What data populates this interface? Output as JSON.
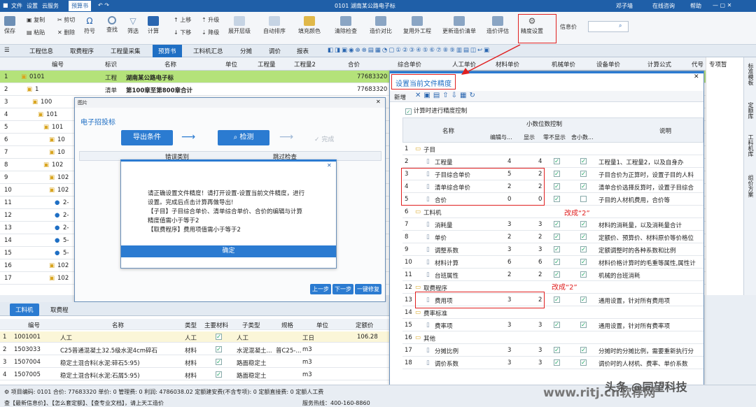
{
  "titlebar": {
    "menus": [
      "文件",
      "设置",
      "云服务",
      "预算书"
    ],
    "doc": "0101 湖南某公路电子标",
    "user": "邓子墙",
    "online": "在线咨询",
    "help": "帮助"
  },
  "ribbon": {
    "save": "保存",
    "copy": "复制",
    "cut": "剪切",
    "paste": "粘贴",
    "delete": "删除",
    "symbol": "符号",
    "find": "查找",
    "filter": "筛选",
    "calc": "计算",
    "up": "上移",
    "down": "下移",
    "upgrade": "升级",
    "downgrade": "降级",
    "expand": "展开层级",
    "autosort": "自动排序",
    "fillcolor": "填充颜色",
    "clearcheck": "清除检查",
    "pricecompare": "造价对比",
    "copyother": "复用外工程",
    "updatelist": "更新造价清单",
    "evaluate": "造价评估",
    "precision": "精度设置",
    "infoprice": "信息价"
  },
  "tabs": [
    "工程信息",
    "取费程序",
    "工程量采集",
    "预算书",
    "工料机汇总",
    "分摊",
    "调价",
    "报表"
  ],
  "grid": {
    "headers": [
      "编号",
      "标识",
      "名称",
      "单位",
      "工程量",
      "工程量2",
      "合价",
      "综合单价",
      "人工单价",
      "材料单价",
      "机械单价",
      "设备单价",
      "计算公式",
      "代号",
      "专项暂"
    ],
    "rows": [
      {
        "n": "1",
        "code": "0101",
        "flag": "工程",
        "name": "湖南某公路电子标",
        "total": "77683320"
      },
      {
        "n": "2",
        "code": "1",
        "flag": "清单",
        "name": "第100章至第800章合计",
        "total": "77683320"
      },
      {
        "n": "3",
        "code": "100",
        "flag": "",
        "name": "",
        "total": ""
      },
      {
        "n": "4",
        "code": "101",
        "flag": "",
        "name": "",
        "total": ""
      },
      {
        "n": "5",
        "code": "101",
        "flag": "",
        "name": "",
        "total": ""
      },
      {
        "n": "6",
        "code": "10",
        "flag": "",
        "name": "",
        "total": ""
      },
      {
        "n": "7",
        "code": "10",
        "flag": "",
        "name": "",
        "total": ""
      },
      {
        "n": "8",
        "code": "102",
        "flag": "",
        "name": "",
        "total": ""
      },
      {
        "n": "9",
        "code": "102",
        "flag": "",
        "name": "",
        "total": ""
      },
      {
        "n": "10",
        "code": "102",
        "flag": "",
        "name": "",
        "total": ""
      },
      {
        "n": "11",
        "code": "2-",
        "flag": "",
        "name": "",
        "total": ""
      },
      {
        "n": "12",
        "code": "2-",
        "flag": "",
        "name": "",
        "total": ""
      },
      {
        "n": "13",
        "code": "2-",
        "flag": "",
        "name": "",
        "total": ""
      },
      {
        "n": "14",
        "code": "5-",
        "flag": "",
        "name": "",
        "total": ""
      },
      {
        "n": "15",
        "code": "5-",
        "flag": "",
        "name": "",
        "total": ""
      },
      {
        "n": "16",
        "code": "102",
        "flag": "",
        "name": "",
        "total": ""
      },
      {
        "n": "17",
        "code": "102",
        "flag": "",
        "name": "",
        "total": ""
      }
    ]
  },
  "sidetabs": [
    "标准模板",
    "定额库",
    "工料机库",
    "组价方案"
  ],
  "ebid": {
    "window_title": "图片",
    "title": "电子招投标",
    "export": "导出条件",
    "check": "检测",
    "done": "完成",
    "col_err": "错误类别",
    "col_skip": "跳过检查",
    "prev": "上一步",
    "next": "下一步",
    "fix": "一键修复",
    "msg_lines": [
      "请正确设置文件精度！请打开设置-设置当前文件精度，进行",
      "设置。完成后点击计算再做导出!",
      "【子目】子目综合单价、清单综合单价、合价的编辑与计算",
      "精度值需小于等于2",
      "【取费程序】费用项值需小于等于2"
    ],
    "ok": "确定"
  },
  "precision": {
    "title": "设置当前文件精度",
    "new": "新增",
    "option": "计算时进行精度控制",
    "col_name": "名称",
    "col_group": "小数位数控制",
    "col_edit": "编辑与...",
    "col_show": "显示",
    "col_zero": "零不显示",
    "col_round": "舍小数...",
    "col_desc": "说明",
    "rows": [
      {
        "n": "1",
        "name": "子目",
        "folder": true,
        "edit": "",
        "show": "",
        "zero": false,
        "round": false,
        "desc": ""
      },
      {
        "n": "2",
        "name": "工程量",
        "folder": false,
        "edit": "4",
        "show": "4",
        "zero": true,
        "round": true,
        "desc": "工程量1、工程量2，以及自身办"
      },
      {
        "n": "3",
        "name": "子目综合单价",
        "folder": false,
        "edit": "5",
        "show": "2",
        "zero": true,
        "round": true,
        "desc": "子目合价为正算时，设置子目的人料"
      },
      {
        "n": "4",
        "name": "清单综合单价",
        "folder": false,
        "edit": "2",
        "show": "2",
        "zero": true,
        "round": true,
        "desc": "清单合价选择反算时，设置子目综合"
      },
      {
        "n": "5",
        "name": "合价",
        "folder": false,
        "edit": "0",
        "show": "0",
        "zero": true,
        "round": false,
        "desc": "子目的人材机费用，合价等"
      },
      {
        "n": "6",
        "name": "工料机",
        "folder": true,
        "edit": "",
        "show": "",
        "zero": false,
        "round": false,
        "desc": ""
      },
      {
        "n": "7",
        "name": "消耗量",
        "folder": false,
        "edit": "3",
        "show": "3",
        "zero": true,
        "round": true,
        "desc": "材料的消耗量，以及消耗量合计"
      },
      {
        "n": "8",
        "name": "单价",
        "folder": false,
        "edit": "2",
        "show": "2",
        "zero": true,
        "round": true,
        "desc": "定额价、预算价、材料原价等价格位"
      },
      {
        "n": "9",
        "name": "调整系数",
        "folder": false,
        "edit": "3",
        "show": "3",
        "zero": true,
        "round": true,
        "desc": "定额调整时的各种系数和比例"
      },
      {
        "n": "10",
        "name": "材料计算",
        "folder": false,
        "edit": "6",
        "show": "6",
        "zero": true,
        "round": true,
        "desc": "材料价格计算时的毛重等属性,属性计"
      },
      {
        "n": "11",
        "name": "台班属性",
        "folder": false,
        "edit": "2",
        "show": "2",
        "zero": true,
        "round": true,
        "desc": "机械的台班消耗"
      },
      {
        "n": "12",
        "name": "取费程序",
        "folder": true,
        "edit": "",
        "show": "",
        "zero": false,
        "round": false,
        "desc": ""
      },
      {
        "n": "13",
        "name": "费用项",
        "folder": false,
        "edit": "3",
        "show": "2",
        "zero": true,
        "round": true,
        "desc": "通用设置，针对所有费用项"
      },
      {
        "n": "14",
        "name": "费率标准",
        "folder": true,
        "edit": "",
        "show": "",
        "zero": false,
        "round": false,
        "desc": ""
      },
      {
        "n": "15",
        "name": "费率项",
        "folder": false,
        "edit": "3",
        "show": "3",
        "zero": true,
        "round": true,
        "desc": "通用设置，针对所有费率项"
      },
      {
        "n": "16",
        "name": "其他",
        "folder": true,
        "edit": "",
        "show": "",
        "zero": false,
        "round": false,
        "desc": ""
      },
      {
        "n": "17",
        "name": "分摊比例",
        "folder": false,
        "edit": "3",
        "show": "3",
        "zero": true,
        "round": true,
        "desc": "分摊时的分摊比例，需要重新执行分"
      },
      {
        "n": "18",
        "name": "调价系数",
        "folder": false,
        "edit": "3",
        "show": "3",
        "zero": true,
        "round": true,
        "desc": "调价时的人材机、费率、单价系数"
      }
    ]
  },
  "annotations": {
    "change1": "改成“2”",
    "change2": "改成“2”"
  },
  "bottom": {
    "tabs": [
      "工料机",
      "取费程"
    ],
    "headers": [
      "编号",
      "名称",
      "类型",
      "主要材料",
      "子类型",
      "规格",
      "单位",
      "定额价"
    ],
    "rows": [
      {
        "code": "1001001",
        "name": "人工",
        "type": "人工",
        "main": true,
        "sub": "人工",
        "spec": "",
        "unit": "工日",
        "price": "106.28"
      },
      {
        "code": "1503033",
        "name": "C25普通混凝土32.5级水泥4cm碎石",
        "type": "材料",
        "main": true,
        "sub": "水泥混凝土...",
        "spec": "普C25-...",
        "unit": "m3",
        "price": ""
      },
      {
        "code": "1507004",
        "name": "稳定土混合料(水泥:碎石5:95)",
        "type": "材料",
        "main": true,
        "sub": "路面稳定土",
        "spec": "",
        "unit": "m3",
        "price": ""
      },
      {
        "code": "1507005",
        "name": "稳定土混合料(水泥:石屑5:95)",
        "type": "材料",
        "main": true,
        "sub": "路面稳定土",
        "spec": "",
        "unit": "m3",
        "price": ""
      }
    ]
  },
  "status": {
    "line1": "项目编码: 0101  合价: 77683320  单价: 0  管理费: 0  利润: 4786038.02  定额建安费(不含专项): 0  定额直接费: 0  定额人工费",
    "line2": "查【最新信息价】、【怎么套定额】、【查专业文档】，请上天工造价",
    "hotline": "服务热线：400-160-8860",
    "watermark": "头条 @同望科技",
    "site": "www.ritj.cn软荐网"
  }
}
